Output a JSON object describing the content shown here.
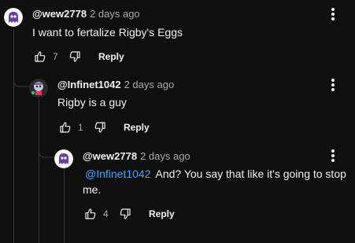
{
  "comments": [
    {
      "author": "@wew2778",
      "date": "2 days ago",
      "text": "I want to fertalize Rigby's Eggs",
      "likes": "7",
      "reply_label": "Reply",
      "avatar_icon": "ghost-avatar-icon"
    },
    {
      "author": "@Infinet1042",
      "date": "2 days ago",
      "text": "Rigby is a guy",
      "likes": "1",
      "reply_label": "Reply",
      "avatar_icon": "character-avatar-icon"
    },
    {
      "author": "@wew2778",
      "date": "2 days ago",
      "mention": "@Infinet1042",
      "text": "And? You say that like it's going to stop me.",
      "likes": "4",
      "reply_label": "Reply",
      "avatar_icon": "ghost-avatar-icon"
    }
  ],
  "colors": {
    "background": "#0f0f0f",
    "text": "#f1f1f1",
    "muted": "#aaaaaa",
    "mention": "#3ea6ff",
    "thread_line": "#3a3a3a"
  }
}
